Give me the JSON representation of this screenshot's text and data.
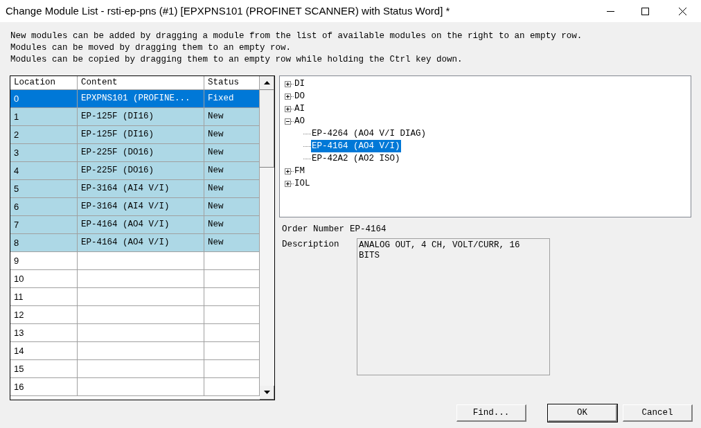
{
  "window": {
    "title": "Change Module List - rsti-ep-pns (#1) [EPXPNS101 (PROFINET SCANNER) with Status Word] *"
  },
  "instructions": [
    "New modules can be added by dragging a module from the list of available modules on the right to an empty row.",
    "Modules can be moved by dragging them to an empty row.",
    "Modules can be copied by dragging them to an empty row while holding the Ctrl key down."
  ],
  "table": {
    "columns": [
      "Location",
      "Content",
      "Status"
    ],
    "rows": [
      {
        "location": "0",
        "content": "EPXPNS101 (PROFINE...",
        "status": "Fixed",
        "selected": true
      },
      {
        "location": "1",
        "content": "EP-125F (DI16)",
        "status": "New",
        "selected": false,
        "occupied": true
      },
      {
        "location": "2",
        "content": "EP-125F (DI16)",
        "status": "New",
        "selected": false,
        "occupied": true
      },
      {
        "location": "3",
        "content": "EP-225F (DO16)",
        "status": "New",
        "selected": false,
        "occupied": true
      },
      {
        "location": "4",
        "content": "EP-225F (DO16)",
        "status": "New",
        "selected": false,
        "occupied": true
      },
      {
        "location": "5",
        "content": "EP-3164 (AI4 V/I)",
        "status": "New",
        "selected": false,
        "occupied": true
      },
      {
        "location": "6",
        "content": "EP-3164 (AI4 V/I)",
        "status": "New",
        "selected": false,
        "occupied": true
      },
      {
        "location": "7",
        "content": "EP-4164 (AO4 V/I)",
        "status": "New",
        "selected": false,
        "occupied": true
      },
      {
        "location": "8",
        "content": "EP-4164 (AO4 V/I)",
        "status": "New",
        "selected": false,
        "occupied": true
      },
      {
        "location": "9",
        "selected": false,
        "occupied": false
      },
      {
        "location": "10",
        "selected": false,
        "occupied": false
      },
      {
        "location": "11",
        "selected": false,
        "occupied": false
      },
      {
        "location": "12",
        "selected": false,
        "occupied": false
      },
      {
        "location": "13",
        "selected": false,
        "occupied": false
      },
      {
        "location": "14",
        "selected": false,
        "occupied": false
      },
      {
        "location": "15",
        "selected": false,
        "occupied": false
      },
      {
        "location": "16",
        "selected": false,
        "occupied": false
      }
    ]
  },
  "tree": {
    "items": [
      {
        "label": "DI",
        "expanded": false
      },
      {
        "label": "DO",
        "expanded": false
      },
      {
        "label": "AI",
        "expanded": false
      },
      {
        "label": "AO",
        "expanded": true,
        "children": [
          {
            "label": "EP-4264 (AO4 V/I DIAG)",
            "selected": false
          },
          {
            "label": "EP-4164 (AO4 V/I)",
            "selected": true
          },
          {
            "label": "EP-42A2 (AO2 ISO)",
            "selected": false
          }
        ]
      },
      {
        "label": "FM",
        "expanded": false
      },
      {
        "label": "IOL",
        "expanded": false
      }
    ]
  },
  "details": {
    "order_number_label": "Order Number",
    "order_number": "EP-4164",
    "description_label": "Description",
    "description": "ANALOG OUT, 4 CH, VOLT/CURR, 16 BITS"
  },
  "buttons": [
    "Find...",
    "OK",
    "Cancel"
  ]
}
